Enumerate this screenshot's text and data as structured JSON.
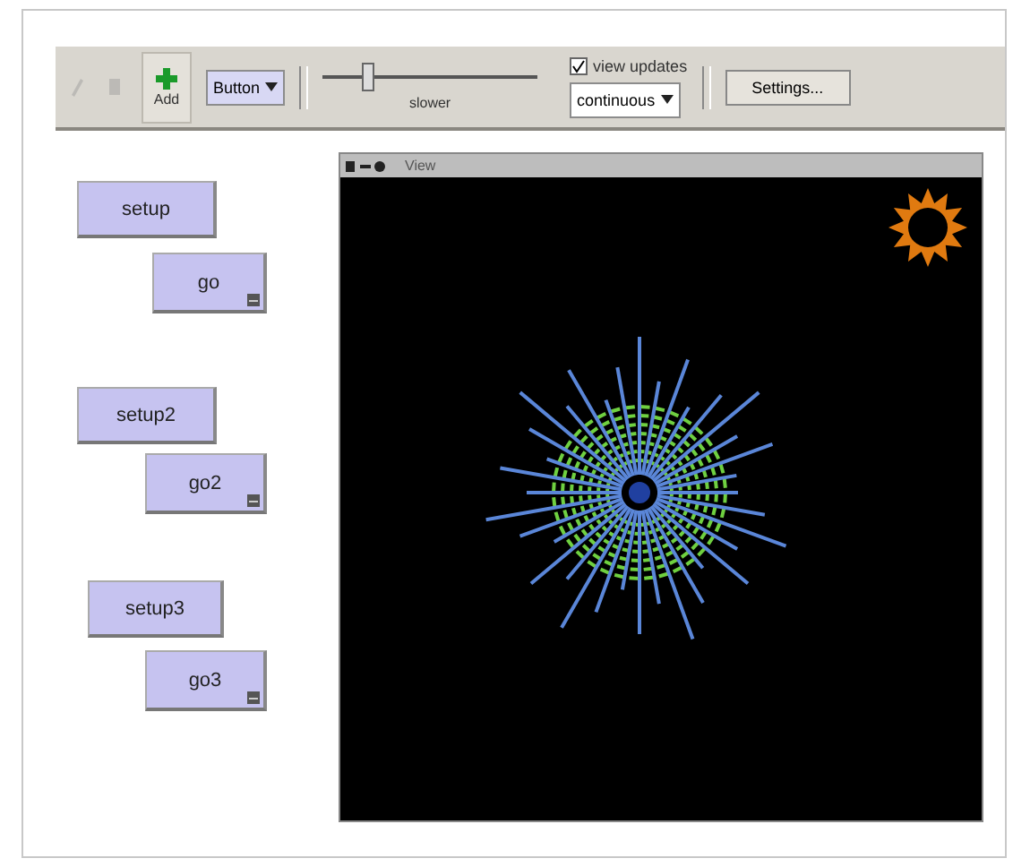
{
  "toolbar": {
    "add_button": {
      "label": "Add"
    },
    "widget_dropdown": {
      "value": "Button"
    },
    "speed_slider": {
      "label": "slower",
      "level": 0.21
    },
    "view_updates": {
      "label": "view updates",
      "checked": true
    },
    "update_mode": {
      "value": "continuous"
    },
    "settings_button": {
      "label": "Settings..."
    }
  },
  "view": {
    "title": "View"
  },
  "buttons": [
    {
      "label": "setup",
      "forever": false
    },
    {
      "label": "go",
      "forever": true
    },
    {
      "label": "setup2",
      "forever": false
    },
    {
      "label": "go2",
      "forever": true
    },
    {
      "label": "setup3",
      "forever": false
    },
    {
      "label": "go3",
      "forever": true
    }
  ]
}
